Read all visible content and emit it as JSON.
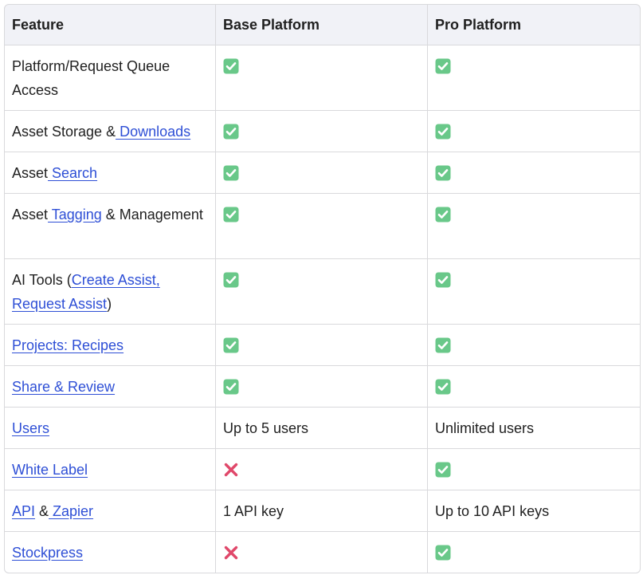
{
  "table": {
    "headers": [
      "Feature",
      "Base Platform",
      "Pro Platform"
    ],
    "rows": [
      {
        "feature_parts": [
          {
            "text": "Platform/Request Queue Access"
          }
        ],
        "base": "yes",
        "pro": "yes"
      },
      {
        "feature_parts": [
          {
            "text": "Asset Storage &"
          },
          {
            "link": " Downloads"
          }
        ],
        "base": "yes",
        "pro": "yes"
      },
      {
        "feature_parts": [
          {
            "text": "Asset"
          },
          {
            "link": " Search"
          }
        ],
        "base": "yes",
        "pro": "yes"
      },
      {
        "feature_parts": [
          {
            "text": "Asset"
          },
          {
            "link": " Tagging"
          },
          {
            "text": " & Management"
          }
        ],
        "base": "yes",
        "pro": "yes"
      },
      {
        "feature_parts": [
          {
            "text": "AI Tools ("
          },
          {
            "link": "Create Assist, "
          },
          {
            "link": "Request Assist"
          },
          {
            "text": ")"
          }
        ],
        "base": "yes",
        "pro": "yes"
      },
      {
        "feature_parts": [
          {
            "link": "Projects: Recipes"
          }
        ],
        "base": "yes",
        "pro": "yes"
      },
      {
        "feature_parts": [
          {
            "link": "Share & Review"
          }
        ],
        "base": "yes",
        "pro": "yes"
      },
      {
        "feature_parts": [
          {
            "link": "Users"
          }
        ],
        "base": "Up to 5 users",
        "pro": "Unlimited users"
      },
      {
        "feature_parts": [
          {
            "link": "White Label"
          }
        ],
        "base": "no",
        "pro": "yes"
      },
      {
        "feature_parts": [
          {
            "link": "API"
          },
          {
            "text": " &"
          },
          {
            "link": " Zapier"
          }
        ],
        "base": "1 API key",
        "pro": "Up to 10 API keys"
      },
      {
        "feature_parts": [
          {
            "link": "Stockpress"
          }
        ],
        "base": "no",
        "pro": "yes"
      }
    ]
  },
  "icons": {
    "yes": "check-mark-button-icon",
    "no": "cross-mark-icon"
  },
  "colors": {
    "link": "#2e4fd6",
    "check_bg": "#69c889",
    "cross": "#e0486a",
    "header_bg": "#f1f2f7",
    "border": "#d9d9dc"
  }
}
